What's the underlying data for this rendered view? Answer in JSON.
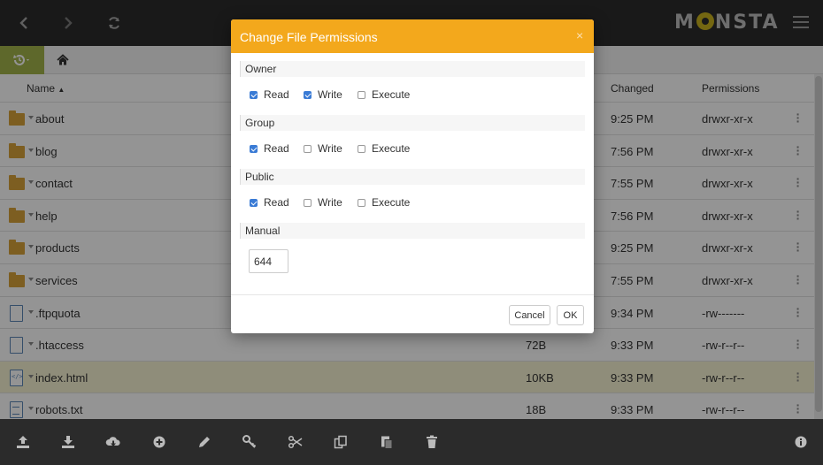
{
  "app": {
    "logo_text_left": "M",
    "logo_text_right": "NSTA",
    "nav": {
      "back_icon": "chevron-left-icon",
      "forward_icon": "chevron-right-icon",
      "refresh_icon": "refresh-icon"
    },
    "menu_icon": "hamburger-icon"
  },
  "colors": {
    "topbar": "#2b2b2b",
    "accent_orange": "#f3a81c",
    "history_green": "#a3b34a",
    "folder": "#d8a33a",
    "file_blue": "#5a86b6",
    "checkbox_blue": "#3a7bd5",
    "selected_row": "#f7f3d2"
  },
  "breadcrumb": {
    "history_icon": "history-icon",
    "home_icon": "home-icon"
  },
  "table": {
    "columns": {
      "name": "Name",
      "changed": "Changed",
      "permissions": "Permissions"
    },
    "sort": "Name ascending",
    "rows": [
      {
        "name": "about",
        "type": "folder",
        "size": "",
        "changed": "9:25 PM",
        "permissions": "drwxr-xr-x"
      },
      {
        "name": "blog",
        "type": "folder",
        "size": "",
        "changed": "7:56 PM",
        "permissions": "drwxr-xr-x"
      },
      {
        "name": "contact",
        "type": "folder",
        "size": "",
        "changed": "7:55 PM",
        "permissions": "drwxr-xr-x"
      },
      {
        "name": "help",
        "type": "folder",
        "size": "",
        "changed": "7:56 PM",
        "permissions": "drwxr-xr-x"
      },
      {
        "name": "products",
        "type": "folder",
        "size": "",
        "changed": "9:25 PM",
        "permissions": "drwxr-xr-x"
      },
      {
        "name": "services",
        "type": "folder",
        "size": "",
        "changed": "7:55 PM",
        "permissions": "drwxr-xr-x"
      },
      {
        "name": ".ftpquota",
        "type": "file",
        "size": "",
        "changed": "9:34 PM",
        "permissions": "-rw-------"
      },
      {
        "name": ".htaccess",
        "type": "file",
        "size": "72B",
        "changed": "9:33 PM",
        "permissions": "-rw-r--r--"
      },
      {
        "name": "index.html",
        "type": "code",
        "size": "10KB",
        "changed": "9:33 PM",
        "permissions": "-rw-r--r--",
        "selected": true
      },
      {
        "name": "robots.txt",
        "type": "text",
        "size": "18B",
        "changed": "9:33 PM",
        "permissions": "-rw-r--r--"
      }
    ]
  },
  "toolbar": {
    "tools": [
      "upload-icon",
      "download-icon",
      "cloud-download-icon",
      "add-icon",
      "edit-icon",
      "key-icon",
      "cut-icon",
      "copy-icon",
      "paste-icon",
      "trash-icon"
    ],
    "info_icon": "info-icon"
  },
  "modal": {
    "title": "Change File Permissions",
    "close": "×",
    "groups": [
      {
        "label": "Owner",
        "read": true,
        "write": true,
        "execute": false
      },
      {
        "label": "Group",
        "read": true,
        "write": false,
        "execute": false
      },
      {
        "label": "Public",
        "read": true,
        "write": false,
        "execute": false
      }
    ],
    "checkbox_labels": {
      "read": "Read",
      "write": "Write",
      "execute": "Execute"
    },
    "manual_label": "Manual",
    "manual_value": "644",
    "cancel_label": "Cancel",
    "ok_label": "OK"
  }
}
